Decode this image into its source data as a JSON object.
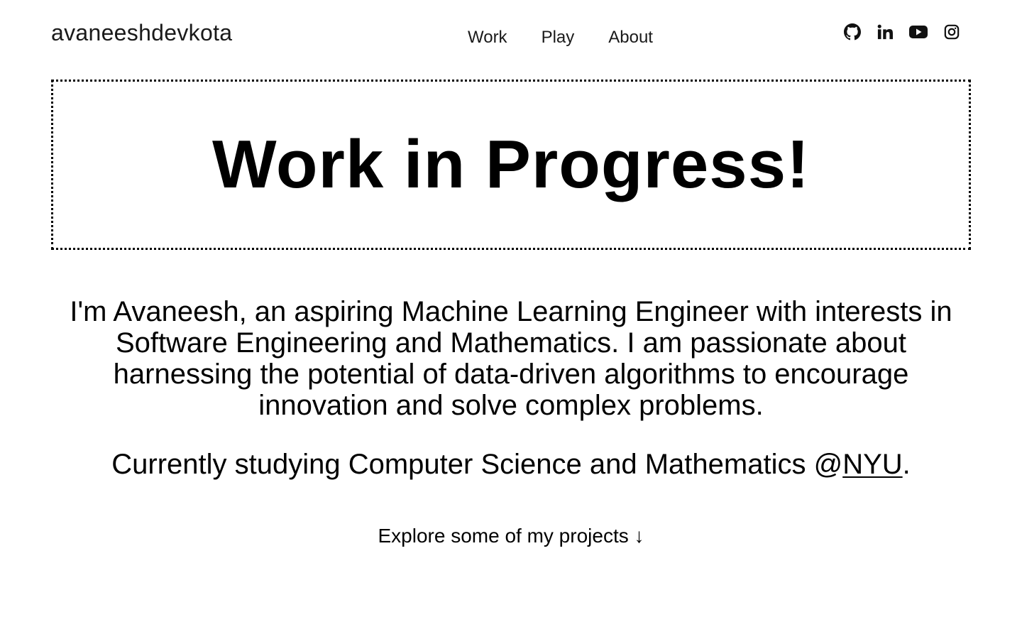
{
  "header": {
    "logo": "avaneeshdevkota",
    "nav": [
      {
        "label": "Work"
      },
      {
        "label": "Play"
      },
      {
        "label": "About"
      }
    ],
    "socials": [
      {
        "icon": "github-icon"
      },
      {
        "icon": "linkedin-icon"
      },
      {
        "icon": "youtube-icon"
      },
      {
        "icon": "instagram-icon"
      }
    ]
  },
  "banner": {
    "title": "Work in Progress!"
  },
  "main": {
    "intro": "I'm Avaneesh, an aspiring Machine Learning Engineer with interests in Software Engineering and Mathematics. I am passionate about harnessing the potential of data-driven algorithms to encourage innovation and solve complex problems.",
    "study_prefix": "Currently studying Computer Science and Mathematics @",
    "study_link": "NYU",
    "study_suffix": ".",
    "explore": "Explore some of my projects ↓"
  },
  "colors": {
    "text": "#111111",
    "background": "#ffffff",
    "border": "#000000"
  }
}
